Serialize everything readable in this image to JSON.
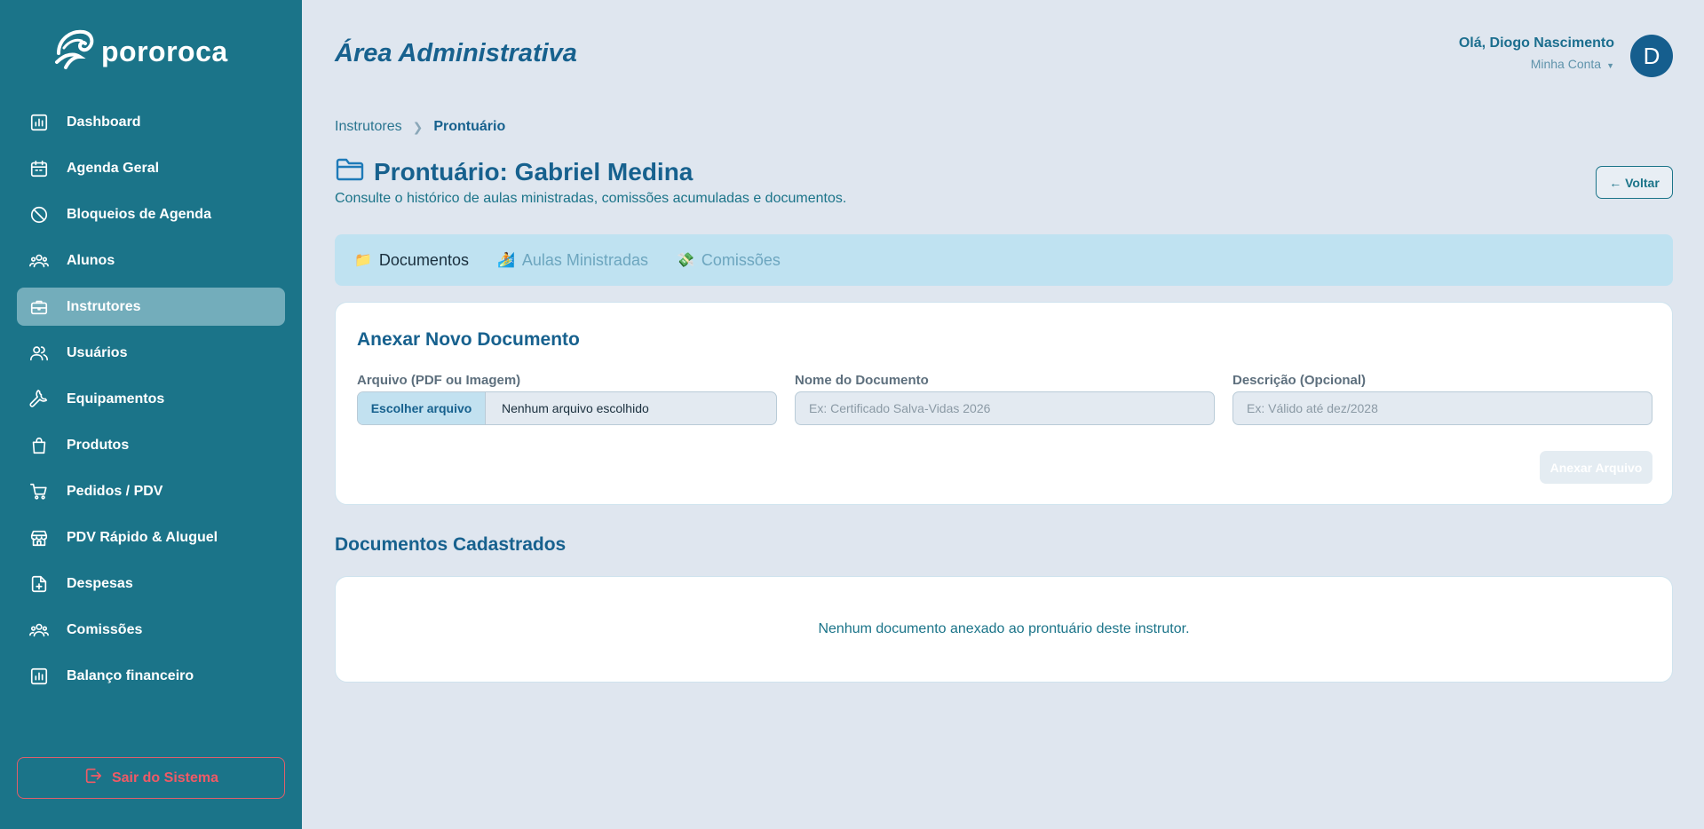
{
  "brand": {
    "name": "pororoca"
  },
  "sidebar": {
    "items": [
      {
        "label": "Dashboard",
        "icon": "chart-icon",
        "active": false
      },
      {
        "label": "Agenda Geral",
        "icon": "calendar-icon",
        "active": false
      },
      {
        "label": "Bloqueios de Agenda",
        "icon": "block-icon",
        "active": false
      },
      {
        "label": "Alunos",
        "icon": "group-icon",
        "active": false
      },
      {
        "label": "Instrutores",
        "icon": "briefcase-icon",
        "active": true
      },
      {
        "label": "Usuários",
        "icon": "users-icon",
        "active": false
      },
      {
        "label": "Equipamentos",
        "icon": "wrench-icon",
        "active": false
      },
      {
        "label": "Produtos",
        "icon": "bag-icon",
        "active": false
      },
      {
        "label": "Pedidos / PDV",
        "icon": "cart-icon",
        "active": false
      },
      {
        "label": "PDV Rápido & Aluguel",
        "icon": "store-icon",
        "active": false
      },
      {
        "label": "Despesas",
        "icon": "file-plus-icon",
        "active": false
      },
      {
        "label": "Comissões",
        "icon": "group-icon",
        "active": false
      },
      {
        "label": "Balanço financeiro",
        "icon": "chart-icon",
        "active": false
      }
    ],
    "logout_label": "Sair do Sistema"
  },
  "header": {
    "area_title": "Área Administrativa",
    "greeting": "Olá, Diogo Nascimento",
    "account_label": "Minha Conta",
    "avatar_initial": "D"
  },
  "breadcrumb": {
    "parent": "Instrutores",
    "current": "Prontuário"
  },
  "page": {
    "title": "Prontuário: Gabriel Medina",
    "subtitle": "Consulte o histórico de aulas ministradas, comissões acumuladas e documentos.",
    "back_label": "← Voltar"
  },
  "tabs": [
    {
      "emoji": "📁",
      "label": "Documentos",
      "active": true
    },
    {
      "emoji": "🏄",
      "label": "Aulas Ministradas",
      "active": false
    },
    {
      "emoji": "💸",
      "label": "Comissões",
      "active": false
    }
  ],
  "form": {
    "title": "Anexar Novo Documento",
    "file_label": "Arquivo (PDF ou Imagem)",
    "file_button": "Escolher arquivo",
    "file_status": "Nenhum arquivo escolhido",
    "name_label": "Nome do Documento",
    "name_placeholder": "Ex: Certificado Salva-Vidas 2026",
    "desc_label": "Descrição (Opcional)",
    "desc_placeholder": "Ex: Válido até dez/2028",
    "submit_label": "Anexar Arquivo"
  },
  "documents": {
    "title": "Documentos Cadastrados",
    "empty_message": "Nenhum documento anexado ao prontuário deste instrutor."
  },
  "colors": {
    "sidebar_bg": "#1b7489",
    "active_item_bg": "#73adbb",
    "primary_text": "#17618e",
    "logout_red": "#f05a66",
    "tabs_bg": "#bfe2f1",
    "page_bg": "#dfe6ef"
  }
}
